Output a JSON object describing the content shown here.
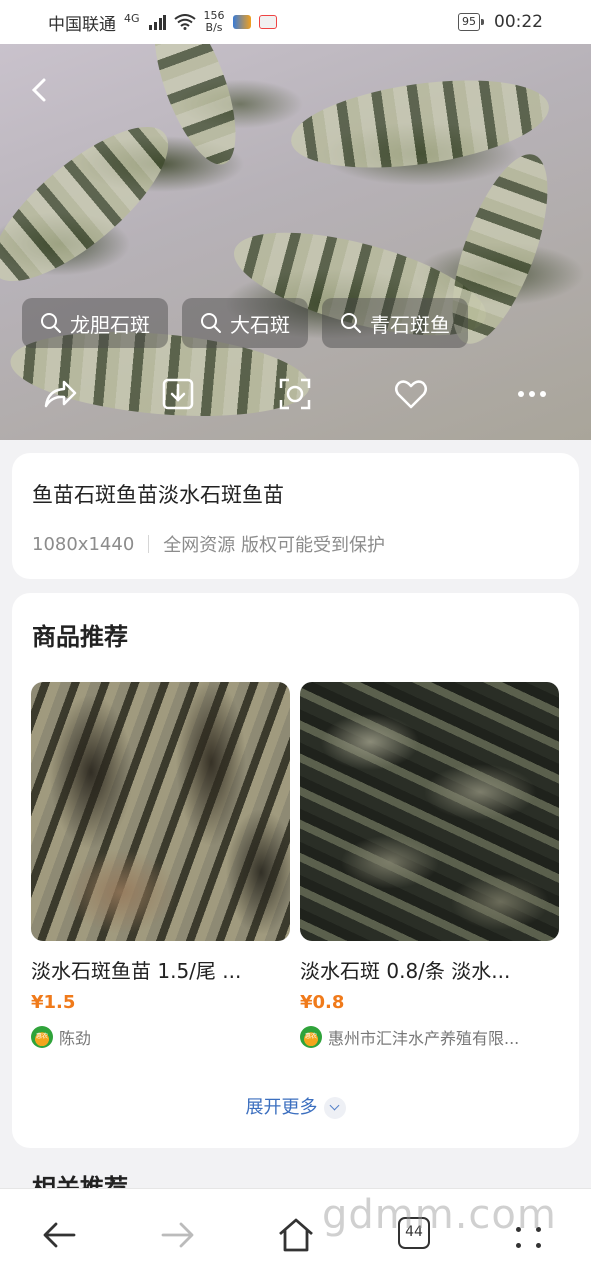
{
  "status_bar": {
    "carrier": "中国联通",
    "signal_type": "4G",
    "net_speed_value": "156",
    "net_speed_unit": "B/s",
    "battery": "95",
    "time": "00:22"
  },
  "hero": {
    "search_chips": [
      {
        "label": "龙胆石斑"
      },
      {
        "label": "大石斑"
      },
      {
        "label": "青石斑鱼"
      }
    ],
    "icons": [
      "share-icon",
      "download-icon",
      "scan-icon",
      "heart-icon",
      "more-icon"
    ]
  },
  "image_info": {
    "title": "鱼苗石斑鱼苗淡水石斑鱼苗",
    "resolution": "1080x1440",
    "source": "全网资源 版权可能受到保护"
  },
  "goods": {
    "heading": "商品推荐",
    "products": [
      {
        "name": "淡水石斑鱼苗 1.5/尾 ...",
        "price": "¥1.5",
        "shop": "陈劲",
        "shop_logo": "惠农"
      },
      {
        "name": "淡水石斑 0.8/条 淡水...",
        "price": "¥0.8",
        "shop": "惠州市汇沣水产养殖有限...",
        "shop_logo": "惠农"
      }
    ],
    "expand_label": "展开更多"
  },
  "related": {
    "heading": "相关推荐"
  },
  "bottom_nav": {
    "tab_count": "44",
    "watermark": "gdmm.com"
  },
  "colors": {
    "price": "#f07a1a",
    "link": "#3c6fbf",
    "background": "#f2f2f4"
  }
}
